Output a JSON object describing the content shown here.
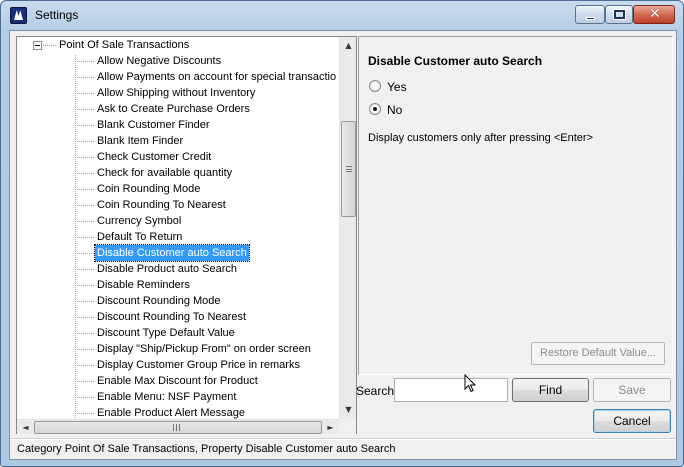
{
  "window": {
    "title": "Settings",
    "icon": "settings-app-icon",
    "controls": [
      "minimize-icon",
      "maximize-icon",
      "close-icon"
    ]
  },
  "tree": {
    "root": "Point Of Sale Transactions",
    "items": [
      "Allow Negative Discounts",
      "Allow Payments on account for special transactio",
      "Allow Shipping without Inventory",
      "Ask to Create Purchase Orders",
      "Blank Customer Finder",
      "Blank Item Finder",
      "Check Customer Credit",
      "Check for available quantity",
      "Coin Rounding Mode",
      "Coin Rounding To Nearest",
      "Currency Symbol",
      "Default To Return",
      "Disable Customer auto Search",
      "Disable Product auto Search",
      "Disable Reminders",
      "Discount Rounding Mode",
      "Discount Rounding To Nearest",
      "Discount Type Default Value",
      "Display \"Ship/Pickup From\" on order screen",
      "Display Customer Group Price in remarks",
      "Enable Max Discount for Product",
      "Enable Menu: NSF Payment",
      "Enable Product Alert Message"
    ],
    "selected": "Disable Customer auto Search",
    "scroll_up_glyph": "▲",
    "scroll_down_glyph": "▼",
    "scroll_left_glyph": "◄",
    "scroll_right_glyph": "►"
  },
  "property": {
    "title": "Disable Customer auto Search",
    "options": [
      {
        "label": "Yes",
        "checked": false
      },
      {
        "label": "No",
        "checked": true
      }
    ],
    "description": "Display customers only after pressing <Enter>",
    "restore_label": "Restore Default Value..."
  },
  "search": {
    "label": "Search",
    "value": ""
  },
  "buttons": {
    "find": "Find",
    "save": "Save",
    "cancel": "Cancel"
  },
  "status": "Category Point Of Sale Transactions, Property Disable Customer auto Search"
}
